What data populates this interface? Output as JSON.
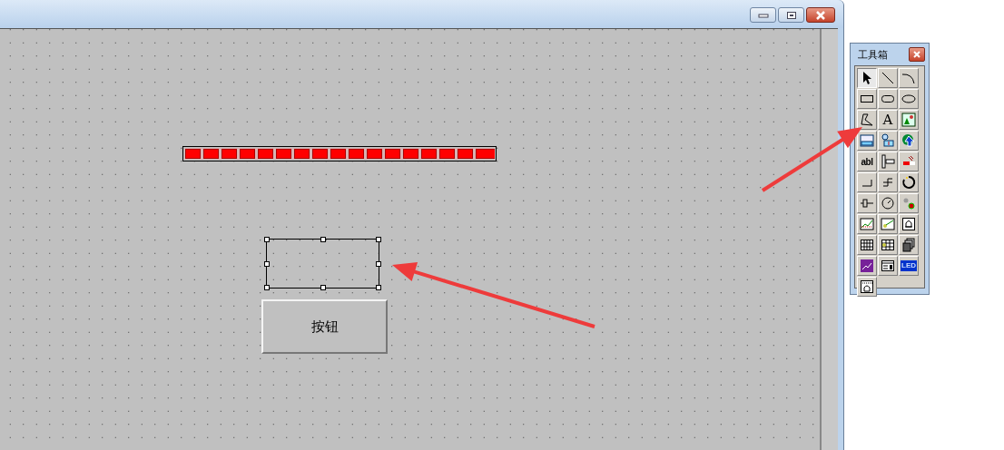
{
  "canvas": {
    "progress": {
      "level": 1
    },
    "selection": {
      "selected": true
    },
    "button": {
      "label": "按钮"
    }
  },
  "toolbox": {
    "title": "工具箱",
    "tools": [
      {
        "kind": "pointer",
        "selected": true
      },
      {
        "kind": "line",
        "selected": false
      },
      {
        "kind": "arc",
        "selected": false
      },
      {
        "kind": "rect",
        "selected": false
      },
      {
        "kind": "roundrect",
        "selected": false
      },
      {
        "kind": "ellipse",
        "selected": false
      },
      {
        "kind": "polygon",
        "selected": false
      },
      {
        "kind": "glyph",
        "label": "A",
        "selected": false
      },
      {
        "kind": "picture",
        "selected": false
      },
      {
        "kind": "monitor",
        "selected": false
      },
      {
        "kind": "component",
        "selected": false
      },
      {
        "kind": "flag",
        "selected": false
      },
      {
        "kind": "textbox",
        "label": "abl",
        "selected": false
      },
      {
        "kind": "ruler",
        "selected": false
      },
      {
        "kind": "bar",
        "selected": false
      },
      {
        "kind": "step",
        "selected": false
      },
      {
        "kind": "step2",
        "selected": false
      },
      {
        "kind": "gauge",
        "selected": false
      },
      {
        "kind": "knob",
        "selected": false
      },
      {
        "kind": "dial",
        "selected": false
      },
      {
        "kind": "dots",
        "selected": false
      },
      {
        "kind": "trend",
        "selected": false
      },
      {
        "kind": "trend2",
        "selected": false
      },
      {
        "kind": "bell",
        "selected": false
      },
      {
        "kind": "grid",
        "selected": false
      },
      {
        "kind": "grid2",
        "selected": false
      },
      {
        "kind": "stack",
        "selected": false
      },
      {
        "kind": "purplechart",
        "selected": false
      },
      {
        "kind": "form",
        "selected": false
      },
      {
        "kind": "led",
        "label": "LED",
        "selected": false
      },
      {
        "kind": "alarm",
        "selected": false
      }
    ]
  },
  "annotations": [
    {
      "kind": "arrow"
    },
    {
      "kind": "arrow"
    }
  ]
}
